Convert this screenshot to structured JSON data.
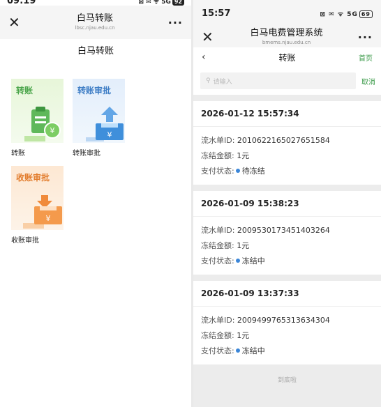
{
  "left": {
    "status": {
      "time": "09:19",
      "icons": "⊠ ✉ ᯤ 5G",
      "battery": "92"
    },
    "wx": {
      "title": "白马转账",
      "subtitle": "lbsc.njau.edu.cn"
    },
    "page_title": "白马转账",
    "tiles": [
      {
        "card_title": "转账",
        "label": "转账",
        "theme": "green",
        "icon": "clipboard-yen-icon"
      },
      {
        "card_title": "转账审批",
        "label": "转账审批",
        "theme": "blue",
        "icon": "tray-upload-yen-icon"
      },
      {
        "card_title": "收账审批",
        "label": "收账审批",
        "theme": "orange",
        "icon": "tray-download-yen-icon"
      }
    ]
  },
  "right": {
    "status": {
      "time": "15:57",
      "icons": "⊠ ✉ ᯤ 5G",
      "battery": "69"
    },
    "wx": {
      "title": "白马电费管理系统",
      "subtitle": "bmems.njau.edu.cn"
    },
    "nav": {
      "back": "‹",
      "title": "转账",
      "home": "首页"
    },
    "search": {
      "placeholder": "请输入",
      "cancel": "取消"
    },
    "labels": {
      "serial": "流水单ID:",
      "amount": "冻结金额:",
      "status": "支付状态:"
    },
    "records": [
      {
        "time": "2026-01-12 15:57:34",
        "serial": "2010622165027651584",
        "amount": "1元",
        "status": "待冻结"
      },
      {
        "time": "2026-01-09 15:38:23",
        "serial": "2009530173451403264",
        "amount": "1元",
        "status": "冻结中"
      },
      {
        "time": "2026-01-09 13:37:33",
        "serial": "2009499765313634304",
        "amount": "1元",
        "status": "冻结中"
      }
    ],
    "end_tip": "到底啦",
    "status_dot_color": "#3b86d8"
  }
}
